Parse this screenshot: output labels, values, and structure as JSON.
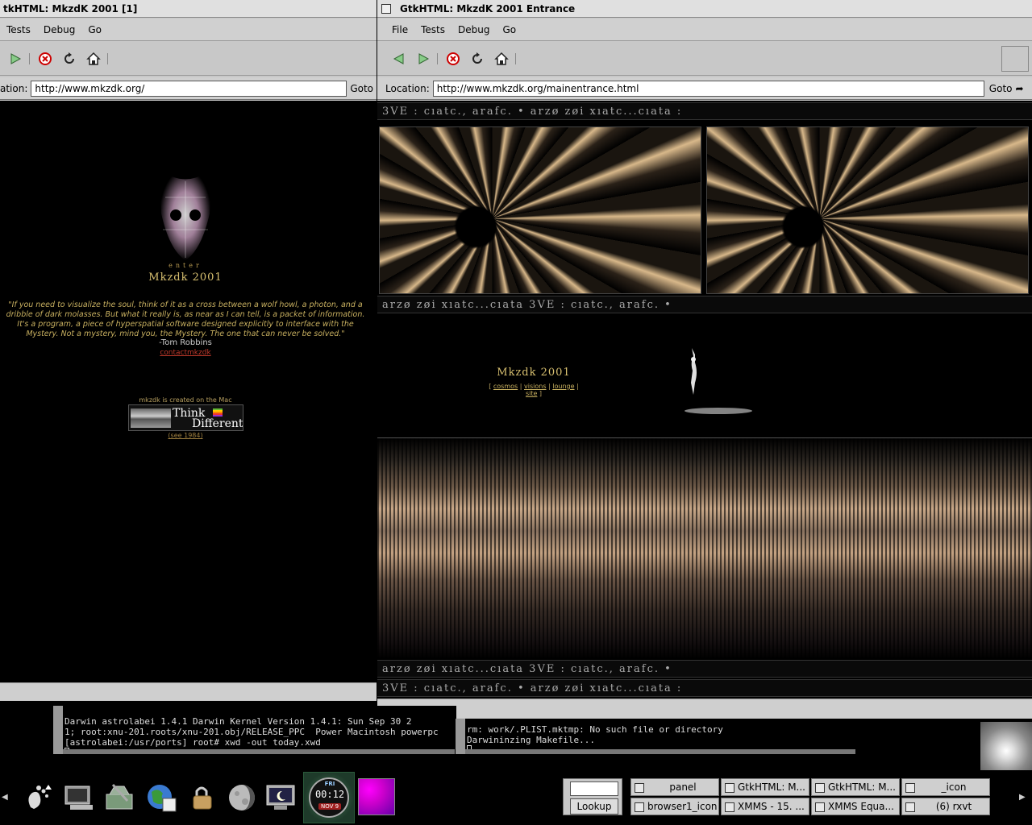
{
  "left_window": {
    "title": "tkHTML: MkzdK 2001   [1]",
    "menu": [
      "Tests",
      "Debug",
      "Go"
    ],
    "location_label": "ation:",
    "location_value": "http://www.mkzdk.org/",
    "goto_label": "Goto",
    "page": {
      "enter_label": "enter",
      "logo_text": "Mkzdk 2001",
      "quote": "\"If you need to visualize the soul, think of it as a cross between a wolf howl, a photon, and a dribble of dark molasses. But what it really is, as near as I can tell, is a packet of information. It's a program, a piece of hyperspatial software designed explicitly to interface with the Mystery. Not a mystery, mind you, the Mystery. The one that can never be solved.\"",
      "quote_author": "-Tom Robbins",
      "contact_link": "contactmkzdk",
      "mac_text": "mkzdk is created on the Mac",
      "banner_think": "Think",
      "banner_different": "Different",
      "see_1984_link": "(see 1984)"
    }
  },
  "right_window": {
    "title": "GtkHTML: MkzdK 2001 Entrance",
    "menu": [
      "File",
      "Tests",
      "Debug",
      "Go"
    ],
    "location_label": "Location:",
    "location_value": "http://www.mkzdk.org/mainentrance.html",
    "goto_label": "Goto",
    "page": {
      "rune_strip_a": "3VE : cıatc., arafc. • arzø zøi xıatc...cıata :",
      "rune_strip_b": "arzø zøi xıatc...cıata 3VE : cıatc., arafc. •",
      "logo_text": "Mkzdk 2001",
      "nav_links": [
        "cosmos",
        "visions",
        "lounge",
        "site"
      ]
    }
  },
  "terminal_left": {
    "lines": [
      "Darwin astrolabei 1.4.1 Darwin Kernel Version 1.4.1: Sun Sep 30 2",
      "1; root:xnu-201.roots/xnu-201.obj/RELEASE_PPC  Power Macintosh powerpc",
      "[astrolabei:/usr/ports] root# xwd -out today.xwd"
    ]
  },
  "terminal_right": {
    "lines": [
      "rm: work/.PLIST.mktmp: No such file or directory",
      "Darwininzing Makefile..."
    ]
  },
  "panel": {
    "clock_day": "FRI",
    "clock_time": "00:12",
    "clock_date": "NOV 9",
    "lookup_label": "Lookup",
    "tasks": [
      "panel",
      "GtkHTML: M...",
      "GtkHTML: M...",
      "_icon",
      "browser1_icon",
      "XMMS - 15. ...",
      "XMMS Equa...",
      "(6) rxvt"
    ]
  }
}
